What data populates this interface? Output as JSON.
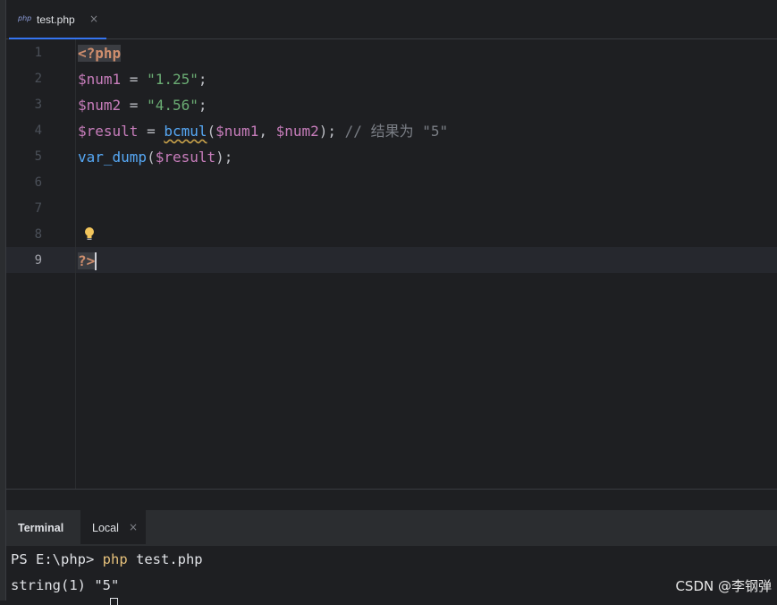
{
  "tabs": [
    {
      "icon": "php-file-icon",
      "icon_text": "php",
      "label": "test.php",
      "close": "×",
      "active": true
    }
  ],
  "editor": {
    "line_numbers": [
      "1",
      "2",
      "3",
      "4",
      "5",
      "6",
      "7",
      "8",
      "9"
    ],
    "current_line": "9",
    "lines": {
      "l1": {
        "open_tag": "<?php"
      },
      "l2": {
        "var": "$num1",
        "op": " = ",
        "str": "\"1.25\"",
        "end": ";"
      },
      "l3": {
        "var": "$num2",
        "op": " = ",
        "str": "\"4.56\"",
        "end": ";"
      },
      "l4": {
        "var": "$result",
        "op": " = ",
        "fn": "bcmul",
        "paren_open": "(",
        "arg1": "$num1",
        "comma": ", ",
        "arg2": "$num2",
        "paren_close": "); ",
        "comment": "// 结果为 \"5\""
      },
      "l5": {
        "fn": "var_dump",
        "paren_open": "(",
        "arg": "$result",
        "paren_close": ");"
      },
      "l9": {
        "close_tag": "?>"
      }
    },
    "bulb_icon": "lightbulb-icon"
  },
  "terminal": {
    "title": "Terminal",
    "tab_label": "Local",
    "tab_close": "×",
    "lines": {
      "prompt": "PS E:\\php> ",
      "cmd": "php",
      "args": " test.php",
      "output": "string(1) \"5\""
    }
  },
  "watermark": "CSDN @李钢弹",
  "colors": {
    "background": "#1e1f22",
    "panel": "#2b2d30",
    "accent": "#3574f0",
    "keyword_tag": "#cf8e6d",
    "variable": "#c77dbb",
    "string": "#6aab73",
    "function": "#56a8f5",
    "comment": "#7a7e85"
  }
}
